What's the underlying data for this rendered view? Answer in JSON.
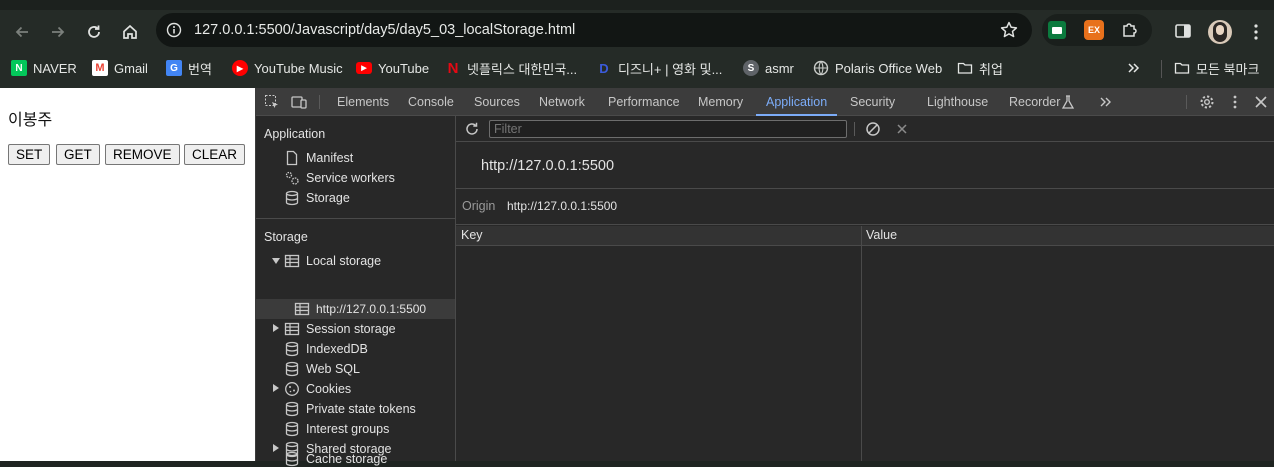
{
  "browser": {
    "url": "127.0.0.1:5500/Javascript/day5/day5_03_localStorage.html",
    "bookmarks": [
      {
        "label": "NAVER",
        "icon": "naver-icon",
        "color": "#03c75a"
      },
      {
        "label": "Gmail",
        "icon": "gmail-icon",
        "color": "#ea4335"
      },
      {
        "label": "번역",
        "icon": "translate-icon",
        "color": "#4285f4"
      },
      {
        "label": "YouTube Music",
        "icon": "youtube-music-icon",
        "color": "#ff0000"
      },
      {
        "label": "YouTube",
        "icon": "youtube-icon",
        "color": "#ff0000"
      },
      {
        "label": "넷플릭스 대한민국...",
        "icon": "netflix-icon",
        "color": "#e50914"
      },
      {
        "label": "디즈니+ | 영화 및...",
        "icon": "disney-icon",
        "color": "#1a3bbd"
      },
      {
        "label": "asmr",
        "icon": "asmr-icon",
        "color": "#5f6368"
      },
      {
        "label": "Polaris Office Web",
        "icon": "globe-icon",
        "color": "#9aa0a6"
      },
      {
        "label": "취업",
        "icon": "folder-icon",
        "color": "#e5e7e5"
      }
    ],
    "all_bookmarks_label": "모든 북마크"
  },
  "page": {
    "heading": "이봉주",
    "buttons": {
      "set": "SET",
      "get": "GET",
      "remove": "REMOVE",
      "clear": "CLEAR"
    }
  },
  "devtools": {
    "tabs": [
      "Elements",
      "Console",
      "Sources",
      "Network",
      "Performance",
      "Memory",
      "Application",
      "Security",
      "Lighthouse",
      "Recorder"
    ],
    "active_tab": "Application",
    "sidebar": {
      "application_title": "Application",
      "application_items": [
        "Manifest",
        "Service workers",
        "Storage"
      ],
      "storage_title": "Storage",
      "storage_items": {
        "local_storage": "Local storage",
        "local_origin": "http://127.0.0.1:5500",
        "session_storage": "Session storage",
        "indexeddb": "IndexedDB",
        "websql": "Web SQL",
        "cookies": "Cookies",
        "private_state_tokens": "Private state tokens",
        "interest_groups": "Interest groups",
        "shared_storage": "Shared storage",
        "cache_storage": "Cache storage"
      }
    },
    "main": {
      "filter_placeholder": "Filter",
      "origin_title": "http://127.0.0.1:5500",
      "origin_label": "Origin",
      "origin_value": "http://127.0.0.1:5500",
      "columns": [
        "Key",
        "Value"
      ]
    },
    "accent_color": "#7cacf8"
  }
}
